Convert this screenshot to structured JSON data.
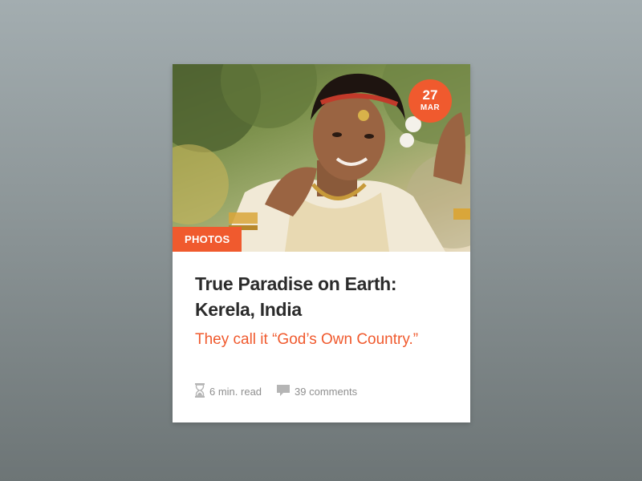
{
  "card": {
    "date": {
      "day": "27",
      "month": "MAR"
    },
    "category": "PHOTOS",
    "title_line1": "True Paradise on Earth:",
    "title_line2": "Kerela, India",
    "subtitle": "They call it “God’s Own Country.”",
    "read_time": "6 min. read",
    "comments": "39 comments"
  },
  "icons": {
    "read_time": "hourglass-icon",
    "comments": "comment-bubble-icon"
  },
  "colors": {
    "accent": "#f05a2e",
    "title": "#2b2b2b",
    "meta": "#8f8f8f",
    "card_bg": "#ffffff"
  }
}
